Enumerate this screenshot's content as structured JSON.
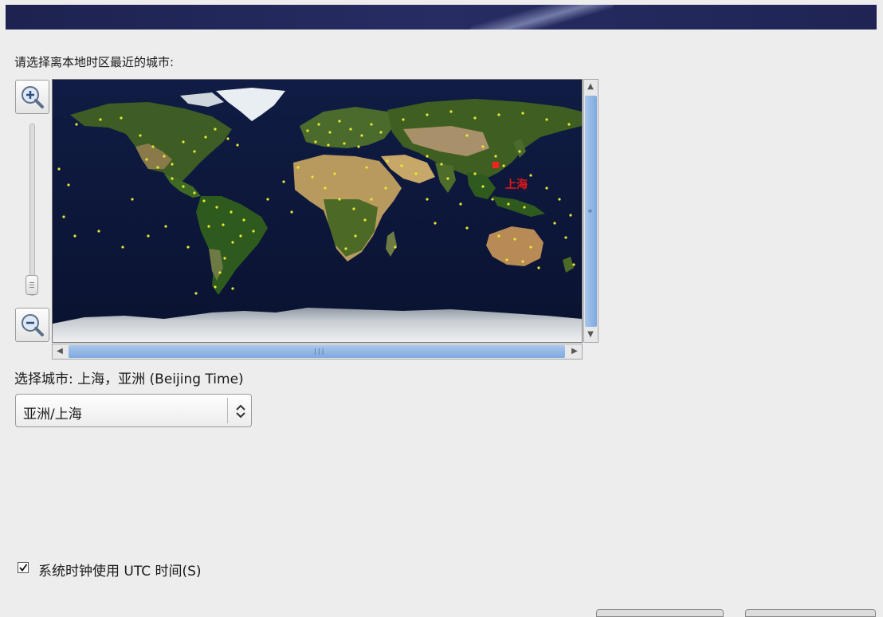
{
  "header": {
    "banner": ""
  },
  "timezone": {
    "prompt": "请选择离本地时区最近的城市:",
    "selected_label": "选择城市: 上海，亚洲 (Beijing Time)",
    "selected_value": "亚洲/上海",
    "map_marker_label": "上海"
  },
  "icons": {
    "zoom_in": "zoom-in-icon",
    "zoom_out": "zoom-out-icon",
    "select_arrows": "chevron-up-down-icon",
    "check": "checkmark-icon"
  },
  "options": {
    "utc_label": "系统时钟使用 UTC 时间(S)",
    "utc_checked": true
  },
  "colors": {
    "banner": "#242a5e",
    "scroll_thumb": "#8fb3e3",
    "city_dot": "#e8e835",
    "selected_city": "#ff2020"
  }
}
